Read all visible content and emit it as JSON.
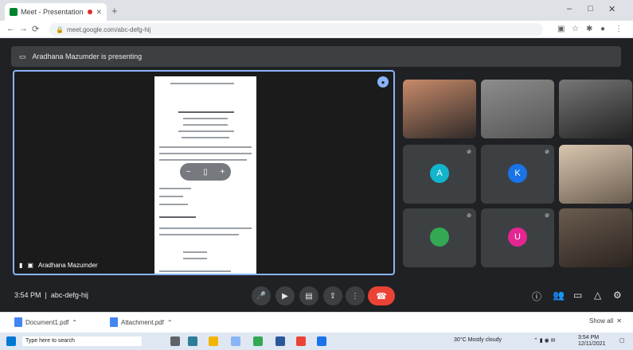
{
  "browser": {
    "tab_title": "Meet - Presentation",
    "address": "meet.google.com/abc-defg-hij",
    "window_controls": [
      "–",
      "□",
      "✕"
    ]
  },
  "meet": {
    "presenting_banner": "Aradhana Mazumder is presenting",
    "presenter_name": "Aradhana Mazumder",
    "time": "3:54 PM",
    "meeting_code": "abc-defg-hij",
    "participants": [
      {
        "name": "",
        "type": "video",
        "colors": [
          "#c98b6a",
          "#2f2a28"
        ]
      },
      {
        "name": "",
        "type": "video",
        "colors": [
          "#8d8d8d",
          "#555555"
        ]
      },
      {
        "name": "",
        "type": "video",
        "colors": [
          "#777777",
          "#222222"
        ]
      },
      {
        "name": "",
        "type": "avatar",
        "initial": "A",
        "avatar_color": "#12b5cb"
      },
      {
        "name": "",
        "type": "avatar",
        "initial": "K",
        "avatar_color": "#1a73e8"
      },
      {
        "name": "",
        "type": "video",
        "colors": [
          "#d9c7b0",
          "#6b5d50"
        ]
      },
      {
        "name": "",
        "type": "avatar",
        "initial": "",
        "avatar_color": "#34a853"
      },
      {
        "name": "",
        "type": "avatar",
        "initial": "U",
        "avatar_color": "#e52592"
      },
      {
        "name": "",
        "type": "video",
        "colors": [
          "#6b5c4f",
          "#2b241f"
        ]
      }
    ]
  },
  "downloads": [
    {
      "name": "Document1.pdf"
    },
    {
      "name": "Attachment.pdf"
    }
  ],
  "download_show_all": "Show all",
  "taskbar": {
    "search_placeholder": "Type here to search",
    "clock_time": "3:54 PM",
    "clock_date": "12/11/2021",
    "status_text": "30°C Mostly cloudy"
  },
  "colors": {
    "accent": "#8ab4f8",
    "end_call": "#ea4335",
    "meet_bg": "#202124"
  }
}
